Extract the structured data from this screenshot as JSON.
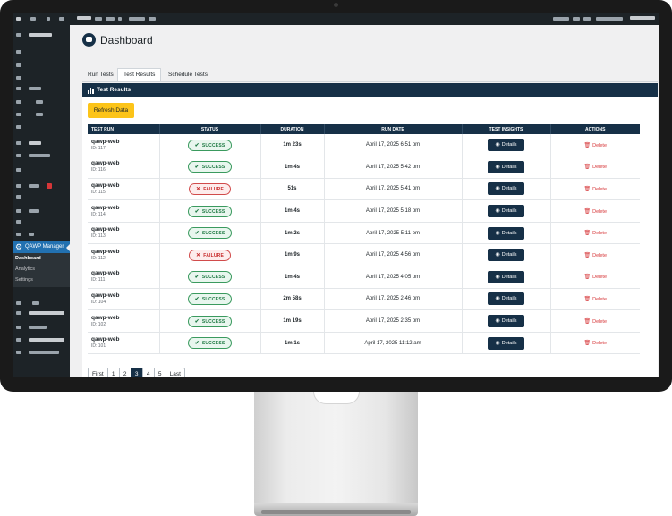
{
  "app": {
    "page_title": "Dashboard",
    "plugin_menu_label": "QAWP Manager"
  },
  "sidebar": {
    "submenu": [
      "Dashboard",
      "Analytics",
      "Settings"
    ],
    "current": "Dashboard"
  },
  "tabs": [
    "Run Tests",
    "Test Results",
    "Schedule Tests"
  ],
  "active_tab": "Test Results",
  "panel": {
    "title": "Test Results",
    "refresh_label": "Refresh Data"
  },
  "table": {
    "headers": [
      "TEST RUN",
      "STATUS",
      "DURATION",
      "RUN DATE",
      "TEST INSIGHTS",
      "ACTIONS"
    ],
    "details_label": "Details",
    "delete_label": "Delete",
    "rows": [
      {
        "name": "qawp-web",
        "id": "ID: 117",
        "status": "SUCCESS",
        "duration": "1m 23s",
        "date": "April 17, 2025 6:51 pm"
      },
      {
        "name": "qawp-web",
        "id": "ID: 116",
        "status": "SUCCESS",
        "duration": "1m 4s",
        "date": "April 17, 2025 5:42 pm"
      },
      {
        "name": "qawp-web",
        "id": "ID: 115",
        "status": "FAILURE",
        "duration": "51s",
        "date": "April 17, 2025 5:41 pm"
      },
      {
        "name": "qawp-web",
        "id": "ID: 114",
        "status": "SUCCESS",
        "duration": "1m 4s",
        "date": "April 17, 2025 5:18 pm"
      },
      {
        "name": "qawp-web",
        "id": "ID: 113",
        "status": "SUCCESS",
        "duration": "1m 2s",
        "date": "April 17, 2025 5:11 pm"
      },
      {
        "name": "qawp-web",
        "id": "ID: 112",
        "status": "FAILURE",
        "duration": "1m 9s",
        "date": "April 17, 2025 4:56 pm"
      },
      {
        "name": "qawp-web",
        "id": "ID: 111",
        "status": "SUCCESS",
        "duration": "1m 4s",
        "date": "April 17, 2025 4:05 pm"
      },
      {
        "name": "qawp-web",
        "id": "ID: 104",
        "status": "SUCCESS",
        "duration": "2m 58s",
        "date": "April 17, 2025 2:46 pm"
      },
      {
        "name": "qawp-web",
        "id": "ID: 102",
        "status": "SUCCESS",
        "duration": "1m 19s",
        "date": "April 17, 2025 2:35 pm"
      },
      {
        "name": "qawp-web",
        "id": "ID: 101",
        "status": "SUCCESS",
        "duration": "1m 1s",
        "date": "April 17, 2025 11:12 am"
      }
    ]
  },
  "pagination": {
    "items": [
      "First",
      "1",
      "2",
      "3",
      "4",
      "5",
      "Last"
    ],
    "current": "3"
  },
  "colors": {
    "brand_navy": "#163047",
    "refresh_yellow": "#fcc419",
    "success_green": "#1f7a44",
    "failure_red": "#c62828",
    "wp_admin_dark": "#1d2327",
    "wp_admin_blue": "#2271b1"
  },
  "icons": {
    "plugin_menu": "gear-icon",
    "panel": "bar-chart-icon",
    "success": "check-circle-icon",
    "failure": "x-icon",
    "details": "eye-icon",
    "delete": "trash-icon",
    "page_logo": "robot-logo-icon"
  }
}
